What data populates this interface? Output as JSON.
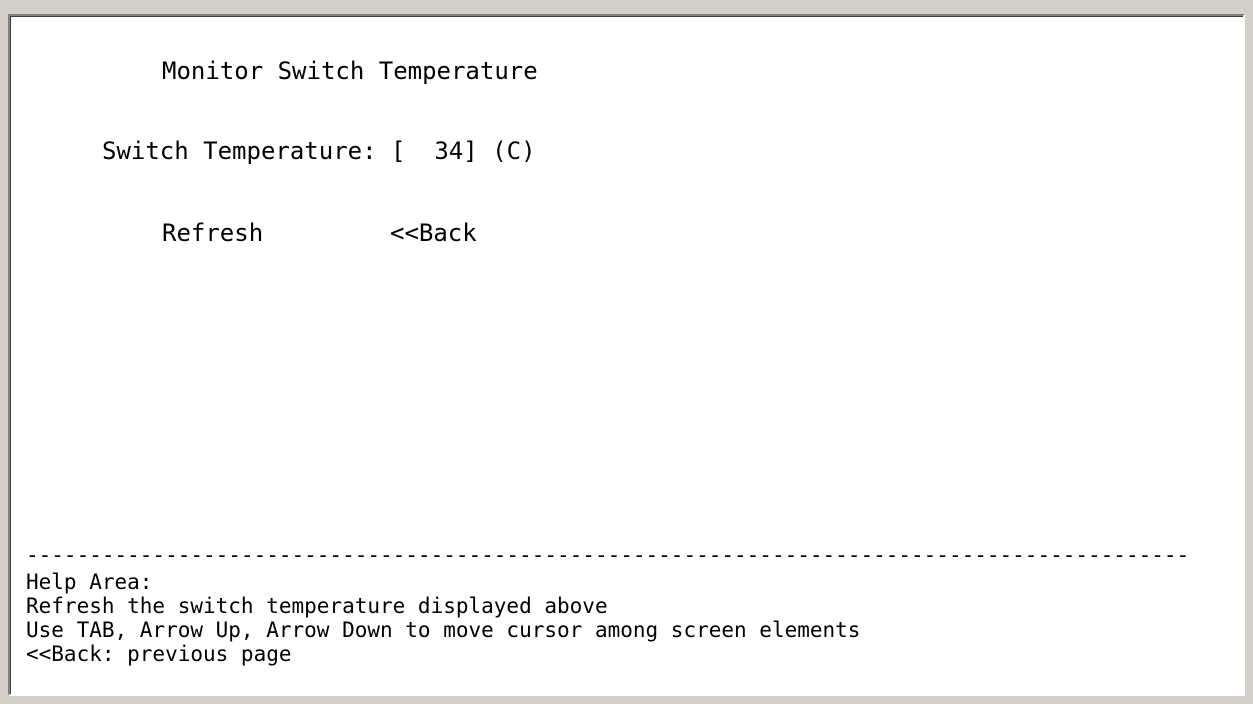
{
  "page": {
    "title": "Monitor Switch Temperature"
  },
  "temperature": {
    "label": "Switch Temperature:",
    "open_bracket": "[",
    "value": "34",
    "close_bracket": "]",
    "unit": "(C)"
  },
  "actions": {
    "refresh_label": "Refresh",
    "back_label": "<<Back"
  },
  "divider": "--------------------------------------------------------------------------------------------",
  "help": {
    "title": "Help Area:",
    "lines": [
      "Refresh the switch temperature displayed above",
      "Use TAB, Arrow Up, Arrow Down to move cursor among screen elements",
      "<<Back: previous page"
    ]
  }
}
